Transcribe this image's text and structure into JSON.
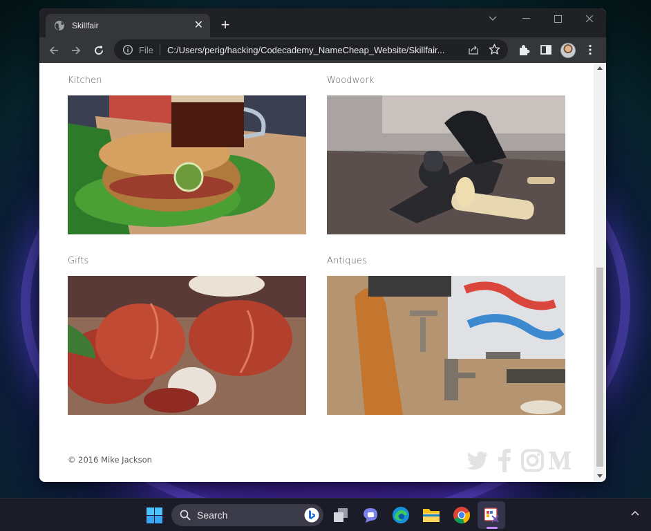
{
  "browser": {
    "tab_title": "Skillfair",
    "address_scheme": "File",
    "address_url": "C:/Users/perig/hacking/Codecademy_NameCheap_Website/Skillfair..."
  },
  "page": {
    "cards": [
      {
        "label": "Kitchen",
        "image": "kitchen-photo"
      },
      {
        "label": "Woodwork",
        "image": "woodwork-photo"
      },
      {
        "label": "Gifts",
        "image": "gifts-photo"
      },
      {
        "label": "Antiques",
        "image": "antiques-photo"
      }
    ],
    "footer_copyright": "© 2016 Mike Jackson",
    "social_icons": [
      "twitter-icon",
      "facebook-icon",
      "instagram-icon",
      "medium-icon"
    ]
  },
  "taskbar": {
    "search_label": "Search",
    "apps": [
      "task-view-icon",
      "teams-chat-icon",
      "edge-icon",
      "file-explorer-icon",
      "chrome-icon",
      "snipping-tool-icon"
    ]
  },
  "colors": {
    "browser_chrome": "#35363a",
    "tabstrip": "#202124",
    "social_icon": "#e3e3e3",
    "label_text": "#5a5a5a"
  }
}
